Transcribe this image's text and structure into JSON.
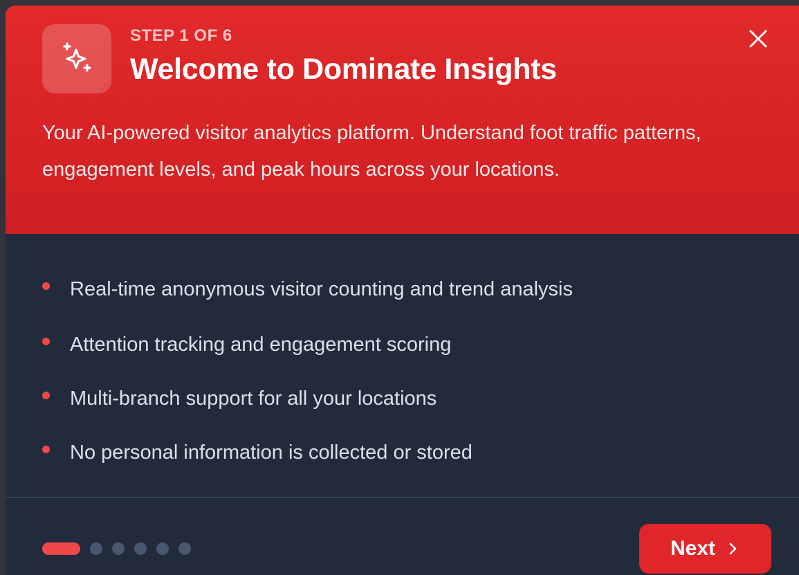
{
  "dialog": {
    "step_label": "STEP 1 OF 6",
    "title": "Welcome to Dominate Insights",
    "description": "Your AI-powered visitor analytics platform. Understand foot traffic patterns, engagement levels, and peak hours across your locations.",
    "header_icon": "sparkles-icon",
    "close_icon": "close-icon",
    "features": [
      "Real-time anonymous visitor counting and trend analysis",
      "Attention tracking and engagement scoring",
      "Multi-branch support for all your locations",
      "No personal information is collected or stored"
    ],
    "pager": {
      "current": 1,
      "total": 6
    },
    "next_label": "Next",
    "next_icon": "chevron-right-icon"
  },
  "colors": {
    "header_red": "#d82325",
    "accent_red": "#f04848",
    "panel_navy": "#222b3b",
    "button_red": "#e0262a",
    "pip_inactive": "#4a5771"
  }
}
